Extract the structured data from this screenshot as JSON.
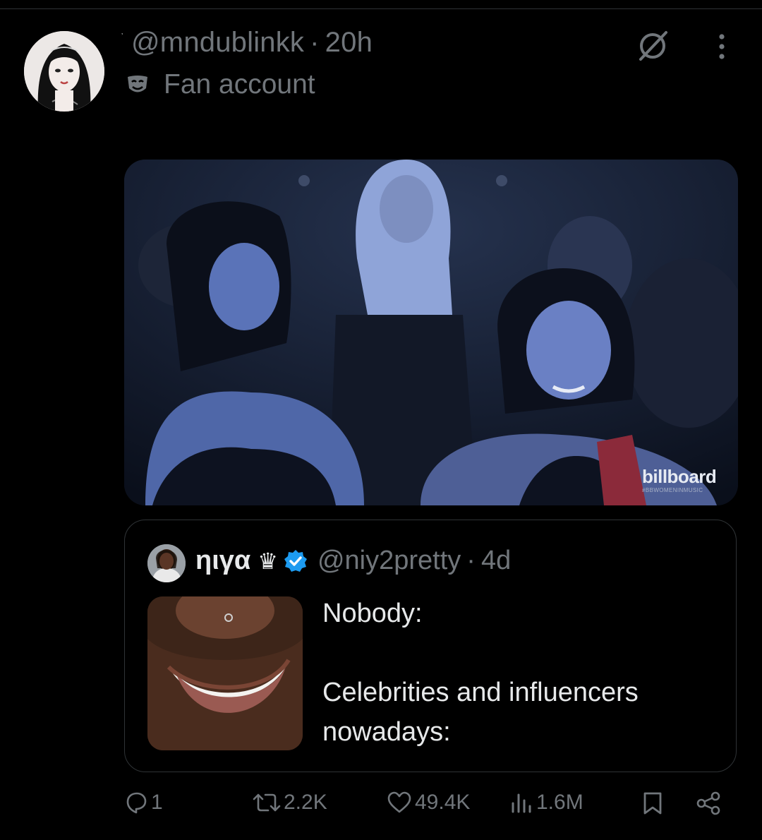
{
  "post": {
    "handle": "@mndublinkk",
    "separator": "·",
    "time": "20h",
    "label_icon": "fan-mask-icon",
    "label": "Fan account",
    "media_watermark": "billboard",
    "media_watermark_sub": "#BBWOMENINMUSIC"
  },
  "quote": {
    "display_name": "ηιγα",
    "name_emoji": "♛",
    "verified": true,
    "handle": "@niy2pretty",
    "separator": "·",
    "time": "4d",
    "text": "Nobody:\n\nCelebrities and influencers nowadays:"
  },
  "actions": {
    "replies": "1",
    "reposts": "2.2K",
    "likes": "49.4K",
    "views": "1.6M"
  },
  "colors": {
    "background": "#000000",
    "text_primary": "#e7e9ea",
    "text_secondary": "#71767b",
    "border": "#2f3336",
    "verified_badge": "#1d9bf0"
  }
}
